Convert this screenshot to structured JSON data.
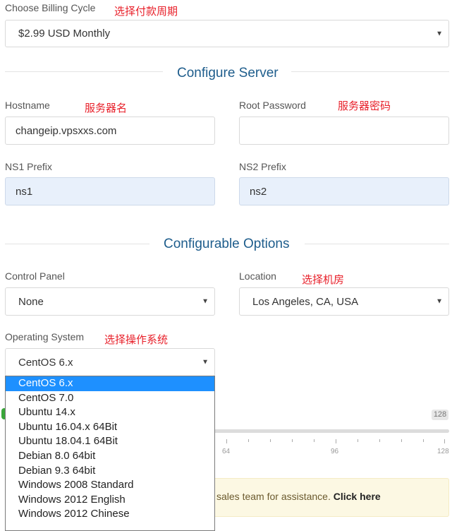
{
  "billing": {
    "label": "Choose Billing Cycle",
    "note": "选择付款周期",
    "value": "$2.99 USD Monthly"
  },
  "configure_server": {
    "title": "Configure Server",
    "hostname_label": "Hostname",
    "hostname_note": "服务器名",
    "hostname_value": "changeip.vpsxxs.com",
    "root_password_label": "Root Password",
    "root_password_note": "服务器密码",
    "root_password_value": "",
    "ns1_label": "NS1 Prefix",
    "ns1_value": "ns1",
    "ns2_label": "NS2 Prefix",
    "ns2_value": "ns2"
  },
  "configurable_options": {
    "title": "Configurable Options",
    "control_panel_label": "Control Panel",
    "control_panel_value": "None",
    "location_label": "Location",
    "location_note": "选择机房",
    "location_value": "Los Angeles, CA, USA",
    "os_label": "Operating System",
    "os_note": "选择操作系统",
    "os_value": "CentOS 6.x",
    "os_options": [
      "CentOS 6.x",
      "CentOS 7.0",
      "Ubuntu 14.x",
      "Ubuntu 16.04.x 64Bit",
      "Ubuntu 18.04.1 64Bit",
      "Debian 8.0 64bit",
      "Debian 9.3 64bit",
      "Windows 2008 Standard",
      "Windows 2012 English",
      "Windows 2012 Chinese"
    ],
    "os_selected_index": 0
  },
  "slider": {
    "value_badge": "128",
    "tick_labels": [
      "64",
      "96",
      "128"
    ]
  },
  "notice": {
    "text": "sales team for assistance.",
    "link": "Click here"
  },
  "colors": {
    "accent": "#1e5d8c",
    "note_red": "#e8202a",
    "selected_option": "#1e90ff",
    "notice_bg": "#fcf8e3"
  },
  "icons": {
    "select_caret": "caret-down-icon"
  }
}
